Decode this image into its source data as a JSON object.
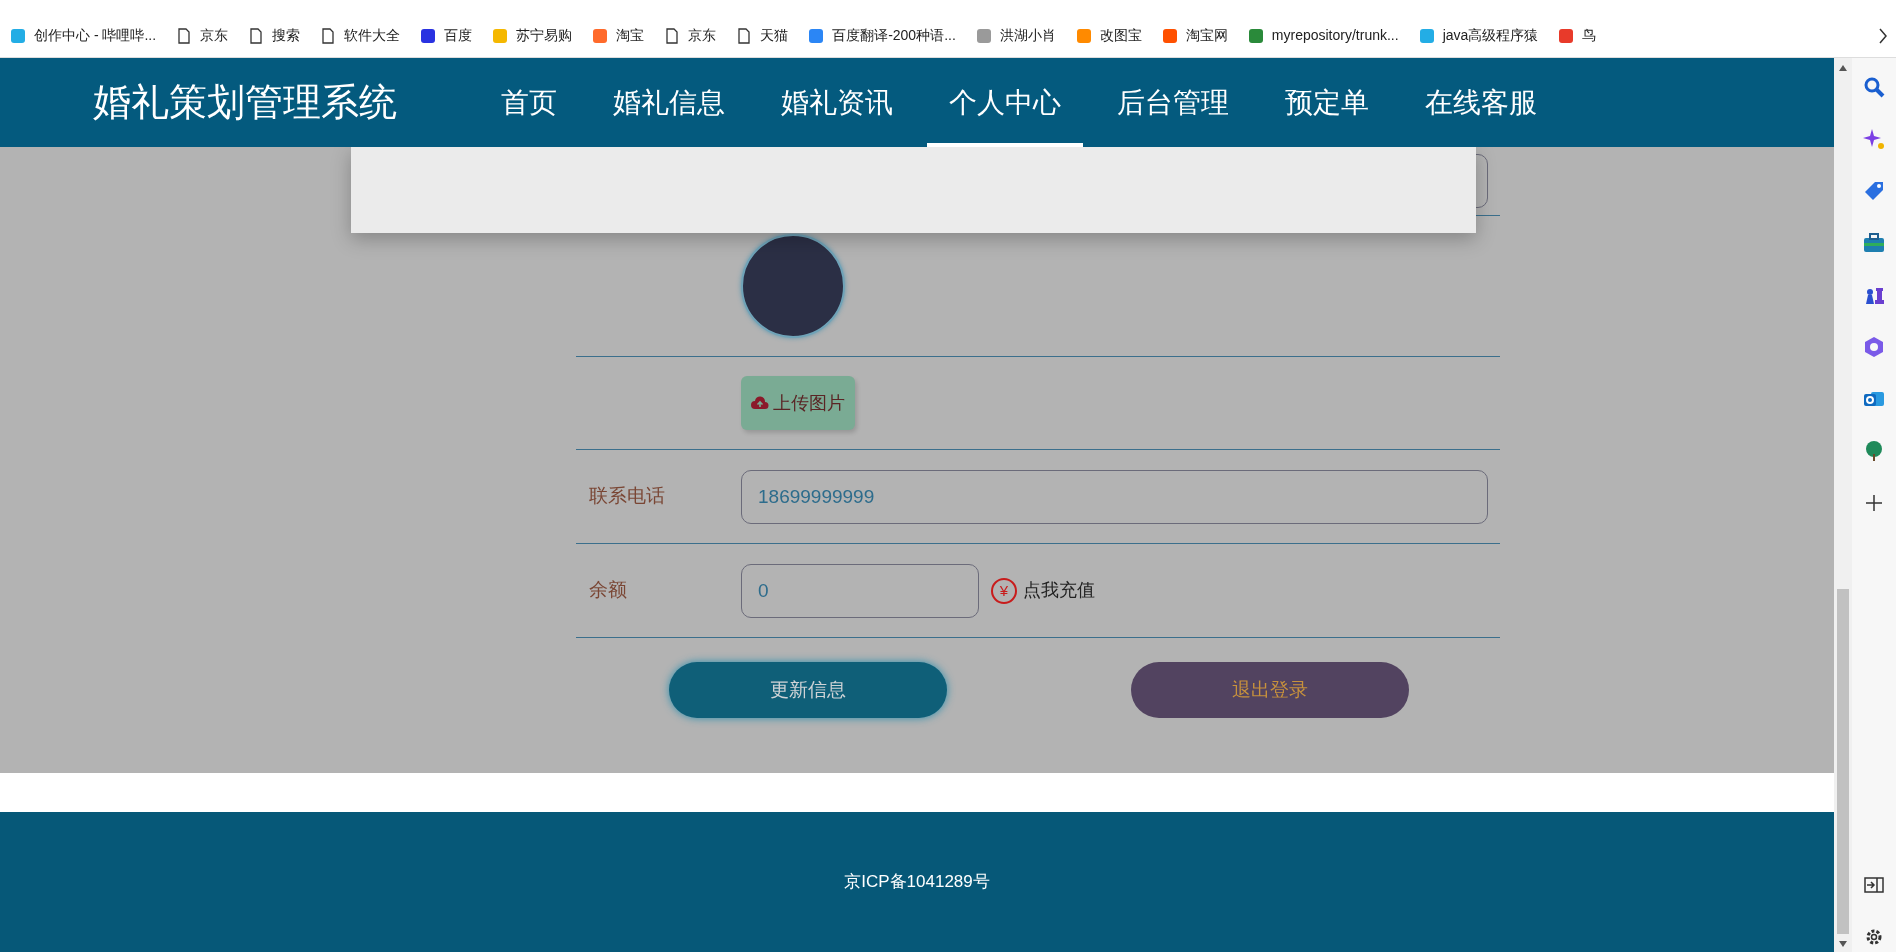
{
  "bookmarks": [
    {
      "label": "创作中心 - 哔哩哔...",
      "kind": "site",
      "color": "#23ade5"
    },
    {
      "label": "京东",
      "kind": "page"
    },
    {
      "label": "搜索",
      "kind": "page"
    },
    {
      "label": "软件大全",
      "kind": "page"
    },
    {
      "label": "百度",
      "kind": "site",
      "color": "#2932e1"
    },
    {
      "label": "苏宁易购",
      "kind": "site",
      "color": "#f5b800"
    },
    {
      "label": "淘宝",
      "kind": "site",
      "color": "#ff6a2b"
    },
    {
      "label": "京东",
      "kind": "page"
    },
    {
      "label": "天猫",
      "kind": "page"
    },
    {
      "label": "百度翻译-200种语...",
      "kind": "site",
      "color": "#2b86f5"
    },
    {
      "label": "洪湖小肖",
      "kind": "site",
      "color": "#9a9a9a"
    },
    {
      "label": "改图宝",
      "kind": "site",
      "color": "#ff8a00"
    },
    {
      "label": "淘宝网",
      "kind": "site",
      "color": "#ff5000"
    },
    {
      "label": "myrepository/trunk...",
      "kind": "site",
      "color": "#2a8a3a"
    },
    {
      "label": "java高级程序猿",
      "kind": "site",
      "color": "#23ade5"
    },
    {
      "label": "鸟",
      "kind": "site",
      "color": "#e83a2a"
    }
  ],
  "site": {
    "title": "婚礼策划管理系统",
    "nav": [
      {
        "label": "首页",
        "selected": false
      },
      {
        "label": "婚礼信息",
        "selected": false
      },
      {
        "label": "婚礼资讯",
        "selected": false
      },
      {
        "label": "个人中心",
        "selected": true
      },
      {
        "label": "后台管理",
        "selected": false
      },
      {
        "label": "预定单",
        "selected": false
      },
      {
        "label": "在线客服",
        "selected": false
      }
    ]
  },
  "profile": {
    "upload_button": "上传图片",
    "fields": [
      {
        "label": "联系电话",
        "value": "18699999999",
        "kind": "wide"
      },
      {
        "label": "余额",
        "value": "0",
        "kind": "short",
        "action_icon": "¥",
        "action": "点我充值"
      }
    ],
    "buttons": [
      {
        "label": "更新信息",
        "kind": "primary"
      },
      {
        "label": "退出登录",
        "kind": "secondary"
      }
    ]
  },
  "footer": {
    "text": "京ICP备1041289号"
  }
}
